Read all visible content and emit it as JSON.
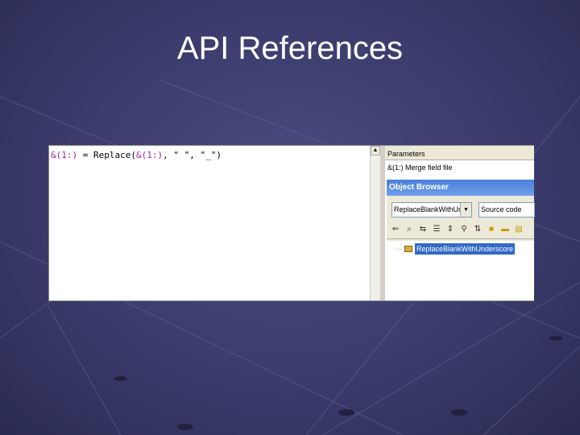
{
  "slide": {
    "title": "API References"
  },
  "editor": {
    "code_parts": [
      "&(1:)",
      " = Replace(",
      "&(1:)",
      ", \" \", \"_\")"
    ]
  },
  "parameters": {
    "title": "Parameters",
    "row": "&(1:) Merge field file"
  },
  "object_browser": {
    "title": "Object Browser",
    "library_select": "ReplaceBlankWithUnde",
    "view_select": "Source code",
    "toolbar_icons": [
      "back-icon",
      "find-icon",
      "references-icon",
      "properties-icon",
      "group-icon",
      "search-icon",
      "sort-icon",
      "class-icon",
      "method-icon",
      "module-icon"
    ],
    "tree_item": "ReplaceBlankWithUnderscore",
    "selection_color": "#316ac5"
  }
}
